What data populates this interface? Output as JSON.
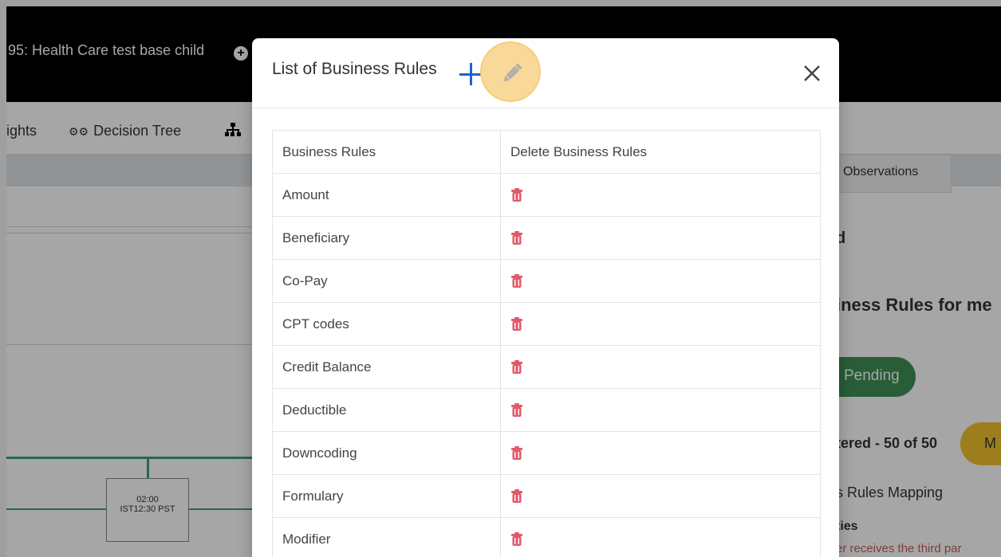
{
  "background": {
    "title": "95: Health Care test base child",
    "tabs": {
      "insights": "ights",
      "decision_tree": "Decision Tree"
    },
    "node": {
      "line1": "02:00",
      "line2": "IST12:30 PST"
    },
    "right_panel": {
      "observations_tab": "Observations",
      "d_text": "d",
      "heading": "iness Rules for me",
      "pending": "Pending",
      "filtered": "tered - 50 of 50",
      "yellow_button": "M",
      "mapping": "s Rules Mapping",
      "ties": "ties",
      "receives": "er receives the third par"
    }
  },
  "modal": {
    "title": "List of Business Rules",
    "headers": {
      "business_rules": "Business Rules",
      "delete": "Delete Business Rules"
    },
    "rows": [
      "Amount",
      "Beneficiary",
      "Co-Pay",
      "CPT codes",
      "Credit Balance",
      "Deductible",
      "Downcoding",
      "Formulary",
      "Modifier"
    ]
  },
  "colors": {
    "accent_blue": "#1a63c8",
    "trash_red": "#e05a6a",
    "pending_green": "#3f8f55",
    "graph_green": "#3e9f86",
    "highlight_yellow": "#f6cc78"
  },
  "icons": [
    "plus-circle-icon",
    "gear-icon",
    "hierarchy-icon",
    "add-icon",
    "edit-pencil-icon",
    "close-icon",
    "trash-icon"
  ]
}
